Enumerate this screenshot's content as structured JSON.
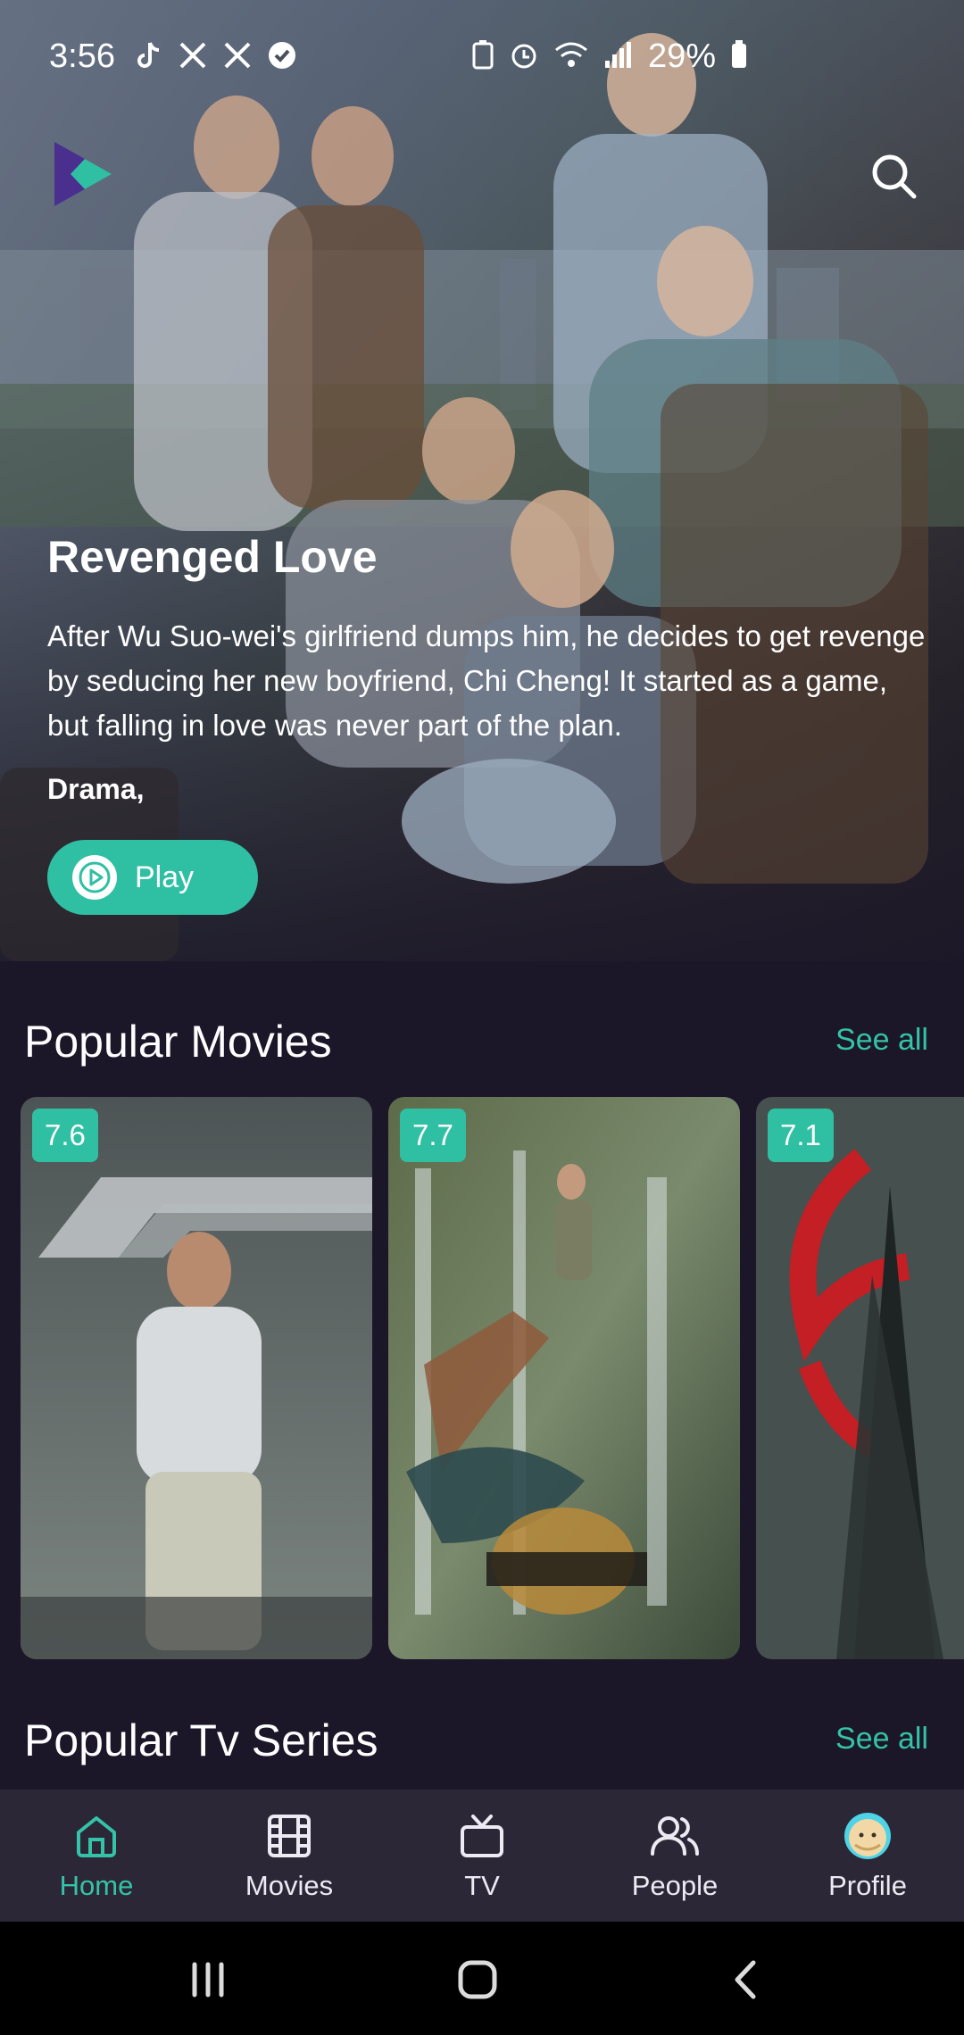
{
  "status_bar": {
    "time": "3:56",
    "battery": "29%",
    "left_icons": [
      "tiktok-icon",
      "x-icon",
      "x-icon",
      "verified-icon"
    ],
    "right_icons": [
      "battery-saver-icon",
      "alarm-icon",
      "wifi-icon",
      "signal-icon",
      "battery-icon"
    ]
  },
  "hero": {
    "title": "Revenged Love",
    "description": "After Wu Suo-wei's girlfriend dumps him, he decides to get revenge by seducing her new boyfriend, Chi Cheng! It started as a game, but falling in love was never part of the plan.",
    "genre": "Drama,",
    "play_label": "Play"
  },
  "popular_movies": {
    "title": "Popular Movies",
    "see_all": "See all",
    "items": [
      {
        "rating": "7.6"
      },
      {
        "rating": "7.7"
      },
      {
        "rating": "7.1"
      }
    ]
  },
  "popular_tv": {
    "title": "Popular Tv Series",
    "see_all": "See all"
  },
  "bottom_nav": [
    {
      "label": "Home",
      "icon": "home-icon",
      "active": true
    },
    {
      "label": "Movies",
      "icon": "film-icon",
      "active": false
    },
    {
      "label": "TV",
      "icon": "tv-icon",
      "active": false
    },
    {
      "label": "People",
      "icon": "people-icon",
      "active": false
    },
    {
      "label": "Profile",
      "icon": "avatar-icon",
      "active": false
    }
  ],
  "colors": {
    "accent": "#35c3a7",
    "background": "#1b1728",
    "nav_background": "#2b2737"
  }
}
